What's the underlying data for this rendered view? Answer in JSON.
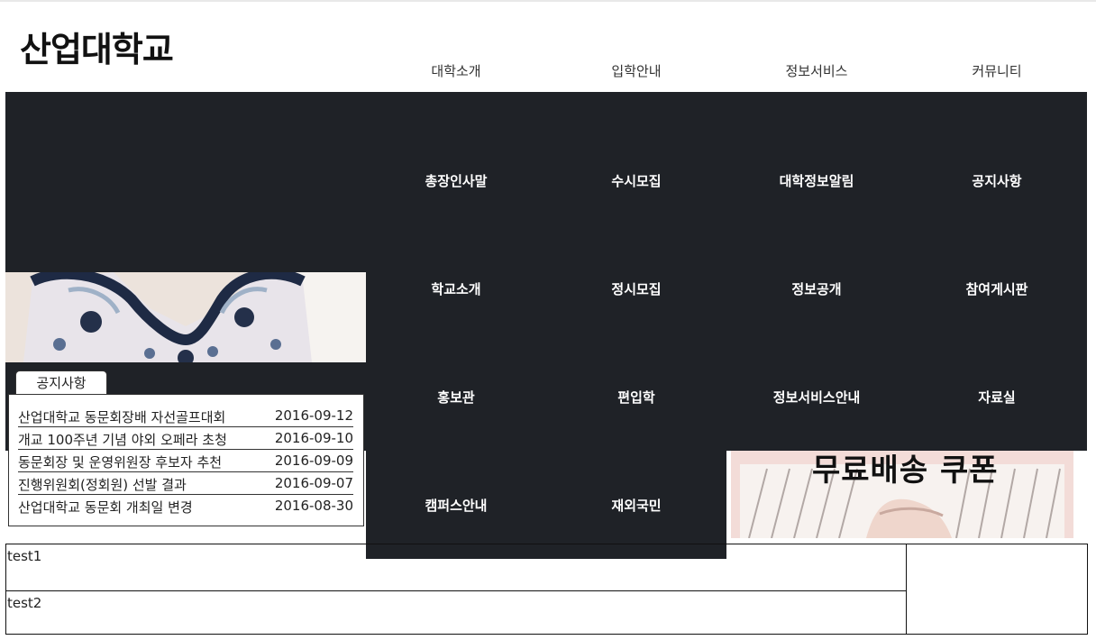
{
  "site": {
    "logo": "산업대학교"
  },
  "nav": [
    {
      "label": "대학소개"
    },
    {
      "label": "입학안내"
    },
    {
      "label": "정보서비스"
    },
    {
      "label": "커뮤니티"
    }
  ],
  "submenu": {
    "col1": [
      "총장인사말",
      "학교소개",
      "홍보관",
      "캠퍼스안내"
    ],
    "col2": [
      "수시모집",
      "정시모집",
      "편입학",
      "재외국민"
    ],
    "col3": [
      "대학정보알림",
      "정보공개",
      "정보서비스안내"
    ],
    "col4": [
      "공지사항",
      "참여게시판",
      "자료실"
    ]
  },
  "notice": {
    "tab_label": "공지사항",
    "items": [
      {
        "title": "산업대학교 동문회장배 자선골프대회",
        "date": "2016-09-12"
      },
      {
        "title": "개교 100주년 기념 야외 오페라 초청",
        "date": "2016-09-10"
      },
      {
        "title": "동문회장 및 운영위원장 후보자 추천",
        "date": "2016-09-09"
      },
      {
        "title": "진행위원회(정회원) 선발 결과",
        "date": "2016-09-07"
      },
      {
        "title": "산업대학교 동문회 개최일 변경",
        "date": "2016-08-30"
      }
    ]
  },
  "banner_right": {
    "text": "무료배송 쿠폰"
  },
  "bottom": {
    "row1": "test1",
    "row2": "test2"
  }
}
